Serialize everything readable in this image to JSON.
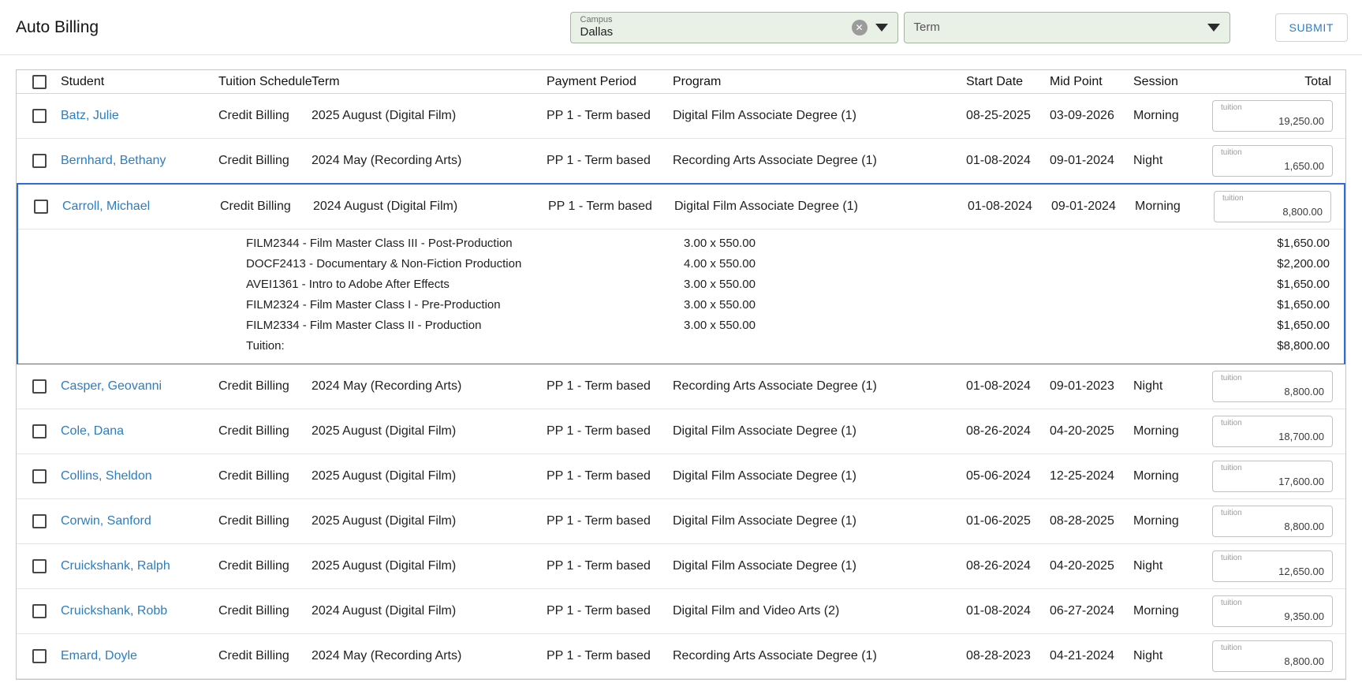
{
  "page": {
    "title": "Auto Billing"
  },
  "filters": {
    "campus_label": "Campus",
    "campus_value": "Dallas",
    "clear_glyph": "✕",
    "term_placeholder": "Term",
    "submit_label": "SUBMIT"
  },
  "table": {
    "columns": [
      "Student",
      "Tuition Schedule",
      "Term",
      "Payment Period",
      "Program",
      "Start Date",
      "Mid Point",
      "Session",
      "Total"
    ],
    "tuition_label": "tuition",
    "rows": [
      {
        "student": "Batz, Julie",
        "tuition_schedule": "Credit Billing",
        "term": "2025 August (Digital Film)",
        "payment_period": "PP 1 - Term based",
        "program": "Digital Film Associate Degree (1)",
        "start_date": "08-25-2025",
        "mid_point": "03-09-2026",
        "session": "Morning",
        "total": "19,250.00",
        "expanded": false
      },
      {
        "student": "Bernhard, Bethany",
        "tuition_schedule": "Credit Billing",
        "term": "2024 May (Recording Arts)",
        "payment_period": "PP 1 - Term based",
        "program": "Recording Arts Associate Degree (1)",
        "start_date": "01-08-2024",
        "mid_point": "09-01-2024",
        "session": "Night",
        "total": "1,650.00",
        "expanded": false
      },
      {
        "student": "Carroll, Michael",
        "tuition_schedule": "Credit Billing",
        "term": "2024 August (Digital Film)",
        "payment_period": "PP 1 - Term based",
        "program": "Digital Film Associate Degree (1)",
        "start_date": "01-08-2024",
        "mid_point": "09-01-2024",
        "session": "Morning",
        "total": "8,800.00",
        "expanded": true,
        "details": [
          {
            "course": "FILM2344 - Film Master Class III - Post-Production",
            "qty": "3.00 x 550.00",
            "amount": "$1,650.00"
          },
          {
            "course": "DOCF2413 - Documentary & Non-Fiction Production",
            "qty": "4.00 x 550.00",
            "amount": "$2,200.00"
          },
          {
            "course": "AVEI1361 - Intro to Adobe After Effects",
            "qty": "3.00 x 550.00",
            "amount": "$1,650.00"
          },
          {
            "course": "FILM2324 - Film Master Class I - Pre-Production",
            "qty": "3.00 x 550.00",
            "amount": "$1,650.00"
          },
          {
            "course": "FILM2334 - Film Master Class II - Production",
            "qty": "3.00 x 550.00",
            "amount": "$1,650.00"
          }
        ],
        "details_total_label": "Tuition:",
        "details_total": "$8,800.00"
      },
      {
        "student": "Casper, Geovanni",
        "tuition_schedule": "Credit Billing",
        "term": "2024 May (Recording Arts)",
        "payment_period": "PP 1 - Term based",
        "program": "Recording Arts Associate Degree (1)",
        "start_date": "01-08-2024",
        "mid_point": "09-01-2023",
        "session": "Night",
        "total": "8,800.00",
        "expanded": false
      },
      {
        "student": "Cole, Dana",
        "tuition_schedule": "Credit Billing",
        "term": "2025 August (Digital Film)",
        "payment_period": "PP 1 - Term based",
        "program": "Digital Film Associate Degree (1)",
        "start_date": "08-26-2024",
        "mid_point": "04-20-2025",
        "session": "Morning",
        "total": "18,700.00",
        "expanded": false
      },
      {
        "student": "Collins, Sheldon",
        "tuition_schedule": "Credit Billing",
        "term": "2025 August (Digital Film)",
        "payment_period": "PP 1 - Term based",
        "program": "Digital Film Associate Degree (1)",
        "start_date": "05-06-2024",
        "mid_point": "12-25-2024",
        "session": "Morning",
        "total": "17,600.00",
        "expanded": false
      },
      {
        "student": "Corwin, Sanford",
        "tuition_schedule": "Credit Billing",
        "term": "2025 August (Digital Film)",
        "payment_period": "PP 1 - Term based",
        "program": "Digital Film Associate Degree (1)",
        "start_date": "01-06-2025",
        "mid_point": "08-28-2025",
        "session": "Morning",
        "total": "8,800.00",
        "expanded": false
      },
      {
        "student": "Cruickshank, Ralph",
        "tuition_schedule": "Credit Billing",
        "term": "2025 August (Digital Film)",
        "payment_period": "PP 1 - Term based",
        "program": "Digital Film Associate Degree (1)",
        "start_date": "08-26-2024",
        "mid_point": "04-20-2025",
        "session": "Night",
        "total": "12,650.00",
        "expanded": false
      },
      {
        "student": "Cruickshank, Robb",
        "tuition_schedule": "Credit Billing",
        "term": "2024 August (Digital Film)",
        "payment_period": "PP 1 - Term based",
        "program": "Digital Film and Video Arts (2)",
        "start_date": "01-08-2024",
        "mid_point": "06-27-2024",
        "session": "Morning",
        "total": "9,350.00",
        "expanded": false
      },
      {
        "student": "Emard, Doyle",
        "tuition_schedule": "Credit Billing",
        "term": "2024 May (Recording Arts)",
        "payment_period": "PP 1 - Term based",
        "program": "Recording Arts Associate Degree (1)",
        "start_date": "08-28-2023",
        "mid_point": "04-21-2024",
        "session": "Night",
        "total": "8,800.00",
        "expanded": false
      }
    ]
  }
}
